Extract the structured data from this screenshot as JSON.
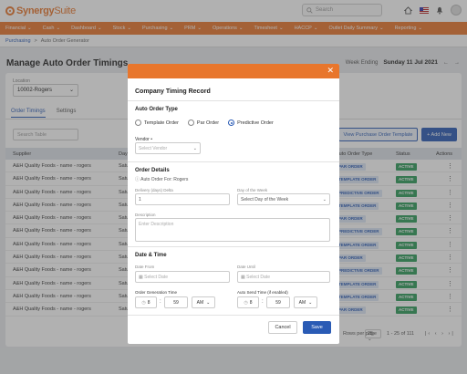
{
  "app": {
    "brand_bold": "Synergy",
    "brand_light": "Suite"
  },
  "search": {
    "placeholder": "Search"
  },
  "nav": [
    {
      "label": "Financial"
    },
    {
      "label": "Cash"
    },
    {
      "label": "Dashboard"
    },
    {
      "label": "Stock"
    },
    {
      "label": "Purchasing"
    },
    {
      "label": "PRM"
    },
    {
      "label": "Operations"
    },
    {
      "label": "Timesheet"
    },
    {
      "label": "HACCP"
    },
    {
      "label": "Outlet Daily Summary"
    },
    {
      "label": "Reporting"
    }
  ],
  "breadcrumb": {
    "item1": "Purchasing",
    "sep": ">",
    "item2": "Auto Order Generator"
  },
  "page": {
    "title": "Manage Auto Order Timings",
    "week_label": "Week Ending",
    "week_value": "Sunday 11 Jul 2021"
  },
  "location": {
    "label": "Location",
    "value": "10002-Rogers"
  },
  "tabs": [
    {
      "label": "Order Timings"
    },
    {
      "label": "Settings"
    }
  ],
  "toolbar": {
    "search_placeholder": "Search Table",
    "view_template_label": "View Purchase Order Template",
    "add_new_label": "+ Add New"
  },
  "table": {
    "headers": {
      "supplier": "Supplier",
      "day": "Day",
      "type": "Auto Order Type",
      "status": "Status",
      "actions": "Actions"
    },
    "rows": [
      {
        "supplier": "A&H Quality Foods - name - rogers",
        "day": "Satu",
        "type": "PAR ORDER",
        "status": "ACTIVE"
      },
      {
        "supplier": "A&H Quality Foods - name - rogers",
        "day": "Satu",
        "type": "TEMPLATE ORDER",
        "status": "ACTIVE"
      },
      {
        "supplier": "A&H Quality Foods - name - rogers",
        "day": "Satu",
        "type": "PREDICTIVE ORDER",
        "status": "ACTIVE"
      },
      {
        "supplier": "A&H Quality Foods - name - rogers",
        "day": "Satu",
        "type": "TEMPLATE ORDER",
        "status": "ACTIVE"
      },
      {
        "supplier": "A&H Quality Foods - name - rogers",
        "day": "Satu",
        "type": "PAR ORDER",
        "status": "ACTIVE"
      },
      {
        "supplier": "A&H Quality Foods - name - rogers",
        "day": "Satu",
        "type": "PREDICTIVE ORDER",
        "status": "ACTIVE"
      },
      {
        "supplier": "A&H Quality Foods - name - rogers",
        "day": "Satu",
        "type": "TEMPLATE ORDER",
        "status": "ACTIVE"
      },
      {
        "supplier": "A&H Quality Foods - name - rogers",
        "day": "Satu",
        "type": "PAR ORDER",
        "status": "ACTIVE"
      },
      {
        "supplier": "A&H Quality Foods - name - rogers",
        "day": "Satu",
        "type": "PREDICTIVE ORDER",
        "status": "ACTIVE"
      },
      {
        "supplier": "A&H Quality Foods - name - rogers",
        "day": "Satu",
        "type": "TEMPLATE ORDER",
        "status": "ACTIVE"
      },
      {
        "supplier": "A&H Quality Foods - name - rogers",
        "day": "Satu",
        "type": "TEMPLATE ORDER",
        "status": "ACTIVE"
      },
      {
        "supplier": "A&H Quality Foods - name - rogers",
        "day": "Satu",
        "type": "PAR ORDER",
        "status": "ACTIVE"
      }
    ]
  },
  "pagination": {
    "rows_label": "Rows per page",
    "per_page": "25",
    "range": "1 - 25 of 111"
  },
  "modal": {
    "title": "Company Timing Record",
    "auto_order_type_title": "Auto Order Type",
    "radio_template": "Template Order",
    "radio_par": "Par Order",
    "radio_predictive": "Predictive Order",
    "vendor_label": "Vendor •",
    "vendor_placeholder": "Select Vendor",
    "order_details_title": "Order Details",
    "auto_order_for": "Auto Order For: Rogers",
    "delivery_days_label": "Delivery (days) Delta",
    "delivery_days_value": "1",
    "day_of_week_label": "Day of the Week",
    "day_of_week_placeholder": "Select Day of the Week",
    "description_label": "Description",
    "description_placeholder": "Enter Description",
    "date_time_title": "Date & Time",
    "date_from_label": "Date From",
    "date_from_placeholder": "Select Date",
    "date_to_label": "Date Until",
    "date_to_placeholder": "Select Date",
    "gen_time_label": "Order Generation Time",
    "gen_hour": "8",
    "gen_min": "59",
    "gen_ampm": "AM",
    "send_time_label": "Auto Send Time (if enabled)",
    "send_hour": "8",
    "send_min": "59",
    "send_ampm": "AM",
    "cancel_label": "Cancel",
    "save_label": "Save"
  },
  "colors": {
    "brand": "#e8762c",
    "primary": "#2a5bb5",
    "active": "#2e9b5a"
  }
}
